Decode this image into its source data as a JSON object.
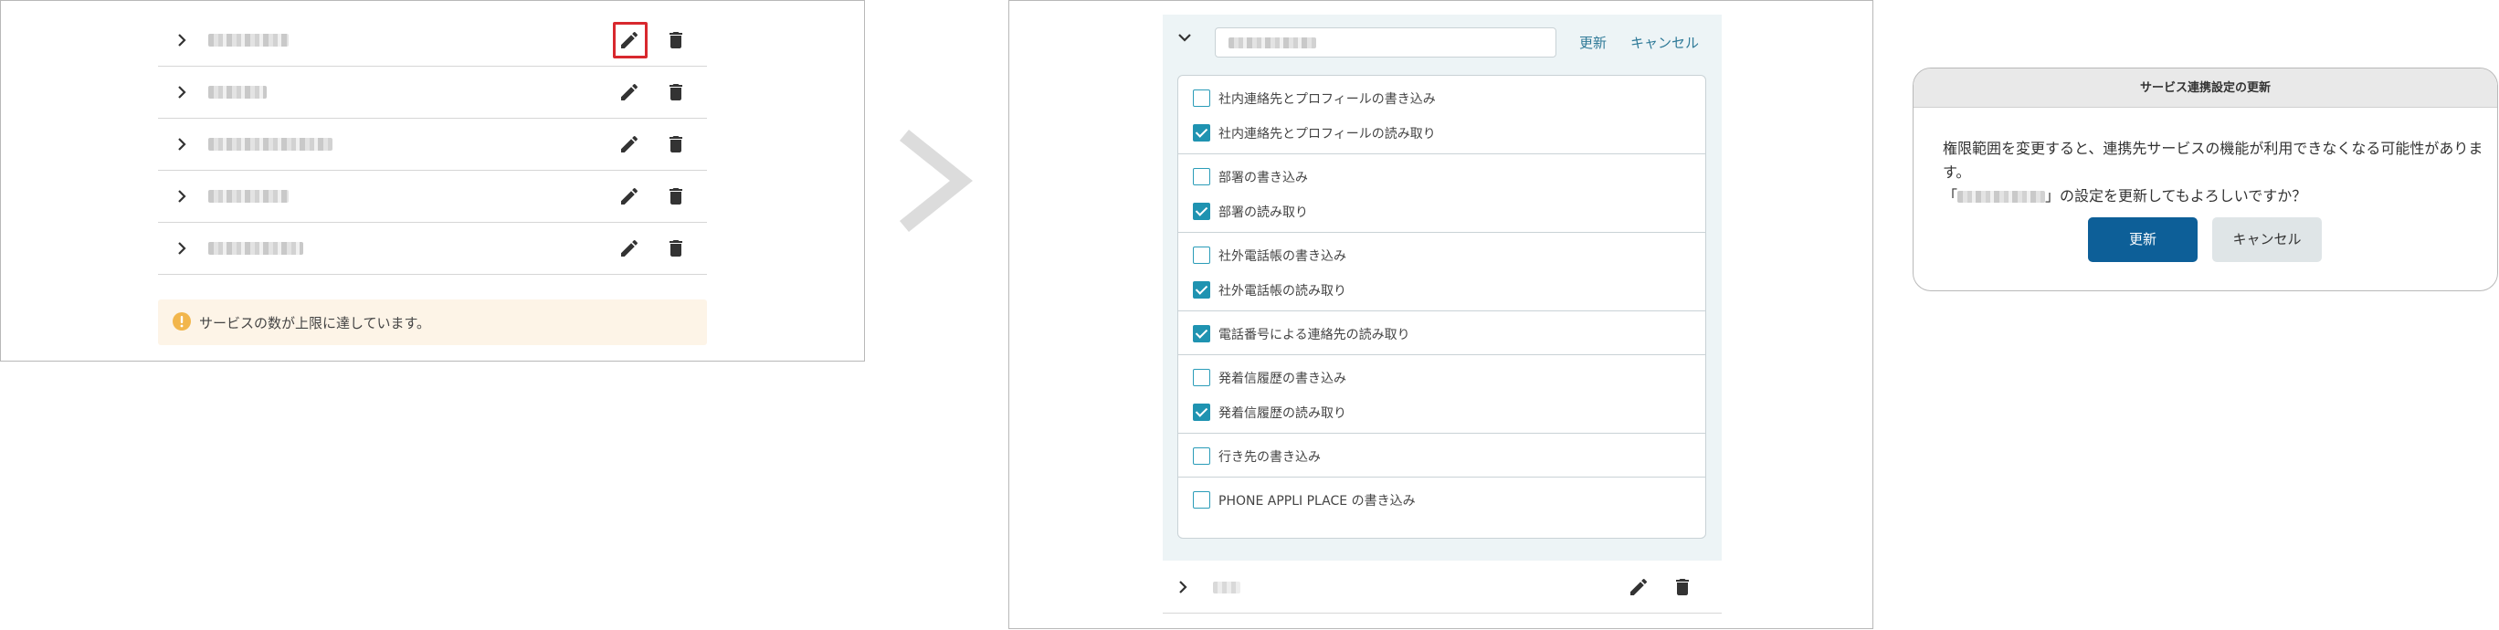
{
  "panel1": {
    "rows": [
      {
        "name_redacted": true
      },
      {
        "name_redacted": true
      },
      {
        "name_redacted": true
      },
      {
        "name_redacted": true
      },
      {
        "name_redacted": true
      }
    ],
    "notice_text": "サービスの数が上限に達しています。"
  },
  "panel2": {
    "update_link": "更新",
    "cancel_link": "キャンセル",
    "permission_groups": [
      [
        {
          "label": "社内連絡先とプロフィールの書き込み",
          "checked": false
        },
        {
          "label": "社内連絡先とプロフィールの読み取り",
          "checked": true
        }
      ],
      [
        {
          "label": "部署の書き込み",
          "checked": false
        },
        {
          "label": "部署の読み取り",
          "checked": true
        }
      ],
      [
        {
          "label": "社外電話帳の書き込み",
          "checked": false
        },
        {
          "label": "社外電話帳の読み取り",
          "checked": true
        }
      ],
      [
        {
          "label": "電話番号による連絡先の読み取り",
          "checked": true
        }
      ],
      [
        {
          "label": "発着信履歴の書き込み",
          "checked": false
        },
        {
          "label": "発着信履歴の読み取り",
          "checked": true
        }
      ],
      [
        {
          "label": "行き先の書き込み",
          "checked": false
        }
      ],
      [
        {
          "label": "PHONE APPLI PLACE の書き込み",
          "checked": false
        }
      ]
    ]
  },
  "dialog": {
    "title": "サービス連携設定の更新",
    "line1": "権限範囲を変更すると、連携先サービスの機能が利用できなくなる可能性がありま",
    "line2": "す。",
    "line3_prefix": "「",
    "line3_suffix": "」の設定を更新してもよろしいですか？",
    "primary_button": "更新",
    "secondary_button": "キャンセル"
  },
  "colors": {
    "accent": "#1f93b1",
    "primary_button": "#0d5f98",
    "highlight": "#d8282e",
    "notice_bg": "#fdf4e7",
    "warn": "#f2b64c"
  }
}
